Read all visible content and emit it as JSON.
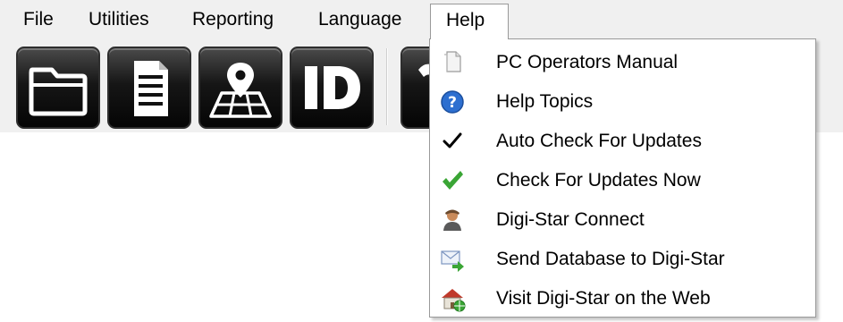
{
  "menubar": {
    "items": [
      {
        "label": "File"
      },
      {
        "label": "Utilities"
      },
      {
        "label": "Reporting"
      },
      {
        "label": "Language"
      },
      {
        "label": "Help"
      }
    ],
    "active": "Help"
  },
  "toolbar": {
    "buttons": [
      {
        "icon": "folder-icon"
      },
      {
        "icon": "document-list-icon"
      },
      {
        "icon": "map-location-icon"
      },
      {
        "icon": "id-icon",
        "text": "ID"
      },
      {
        "icon": "partial-button-icon"
      }
    ]
  },
  "help_menu": {
    "items": [
      {
        "label": "PC Operators Manual",
        "icon": "document-pages-icon"
      },
      {
        "label": "Help Topics",
        "icon": "question-circle-icon"
      },
      {
        "label": "Auto Check For Updates",
        "icon": "checkmark-icon",
        "checked": true
      },
      {
        "label": "Check For Updates Now",
        "icon": "green-check-icon"
      },
      {
        "label": "Digi-Star Connect",
        "icon": "user-person-icon"
      },
      {
        "label": "Send Database to Digi-Star",
        "icon": "send-envelope-icon"
      },
      {
        "label": "Visit Digi-Star on the Web",
        "icon": "web-house-icon"
      }
    ]
  },
  "colors": {
    "chrome": "#f0f0f0",
    "menu_border": "#999999",
    "help_blue": "#2d6fd0",
    "update_green": "#3aa535"
  }
}
